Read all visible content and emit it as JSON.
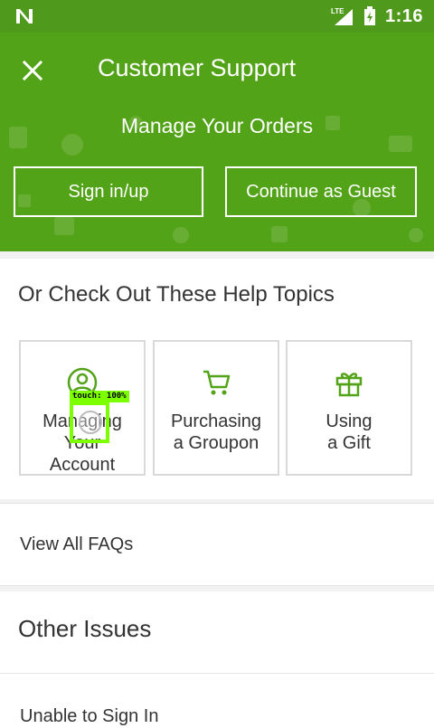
{
  "status_bar": {
    "time": "1:16",
    "network": "LTE"
  },
  "app_bar": {
    "title": "Customer Support"
  },
  "hero": {
    "subtitle": "Manage Your Orders",
    "sign_in_label": "Sign in/up",
    "guest_label": "Continue as Guest"
  },
  "help_topics": {
    "heading": "Or Check Out These Help Topics",
    "cards": [
      {
        "label": "Managing Your Account",
        "icon": "user-circle-icon"
      },
      {
        "label": "Purchasing a Groupon",
        "icon": "shopping-cart-icon"
      },
      {
        "label": "Using a Gift",
        "icon": "gift-icon"
      }
    ]
  },
  "faq": {
    "label": "View All FAQs"
  },
  "other_issues": {
    "heading": "Other Issues",
    "items": [
      {
        "label": "Unable to Sign In"
      }
    ]
  },
  "touch_overlay": {
    "text": "touch: 100%"
  },
  "colors": {
    "brand_green": "#53a318",
    "status_green": "#4f9a1c",
    "icon_green": "#53a318",
    "overlay_green": "#7cff00"
  }
}
